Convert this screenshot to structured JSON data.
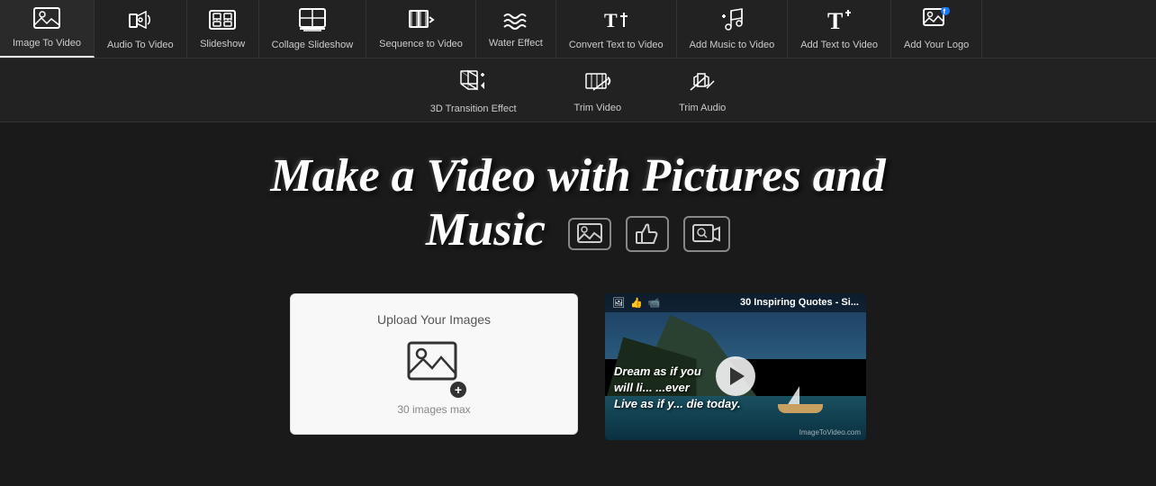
{
  "nav": {
    "items": [
      {
        "id": "image-to-video",
        "icon": "🖼",
        "label": "Image To Video",
        "active": true
      },
      {
        "id": "audio-to-video",
        "icon": "🎵",
        "label": "Audio To Video",
        "active": false
      },
      {
        "id": "slideshow",
        "icon": "📋",
        "label": "Slideshow",
        "active": false
      },
      {
        "id": "collage-slideshow",
        "icon": "📎",
        "label": "Collage Slideshow",
        "active": false
      },
      {
        "id": "sequence-to-video",
        "icon": "🎞",
        "label": "Sequence to Video",
        "active": false
      },
      {
        "id": "water-effect",
        "icon": "〰",
        "label": "Water Effect",
        "active": false
      },
      {
        "id": "convert-text-to-video",
        "icon": "📝",
        "label": "Convert Text to Video",
        "active": false
      },
      {
        "id": "add-music-to-video",
        "icon": "🎶",
        "label": "Add Music to Video",
        "active": false
      },
      {
        "id": "add-text-to-video",
        "icon": "T+",
        "label": "Add Text to Video",
        "active": false
      },
      {
        "id": "add-your-logo",
        "icon": "🖼",
        "label": "Add Your Logo",
        "active": false
      }
    ]
  },
  "second_nav": {
    "items": [
      {
        "id": "3d-transition",
        "icon": "⚡",
        "label": "3D Transition Effect"
      },
      {
        "id": "trim-video",
        "icon": "✂",
        "label": "Trim Video"
      },
      {
        "id": "trim-audio",
        "icon": "✂",
        "label": "Trim Audio"
      }
    ]
  },
  "hero": {
    "title_line1": "Make a Video with Pictures and",
    "title_line2": "Music"
  },
  "upload": {
    "label": "Upload Your Images",
    "limit": "30 images max",
    "plus": "+"
  },
  "video_preview": {
    "title": "30 Inspiring Quotes - Si...",
    "quote_line1": "Dream as if you",
    "quote_line2": "will li...   ...ever",
    "quote_line3": "Live as if y...  die today.",
    "watermark": "ImageToVideo.com"
  }
}
